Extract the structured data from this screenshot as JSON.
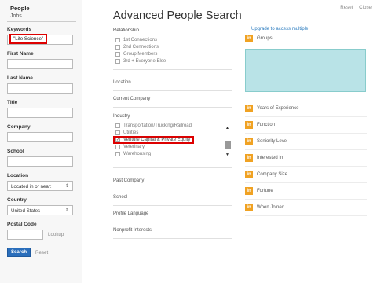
{
  "left": {
    "tabs": {
      "people": "People",
      "jobs": "Jobs"
    },
    "keywords": {
      "label": "Keywords",
      "value": "\"Life Science\""
    },
    "first_name": {
      "label": "First Name",
      "value": ""
    },
    "last_name": {
      "label": "Last Name",
      "value": ""
    },
    "title": {
      "label": "Title",
      "value": ""
    },
    "company": {
      "label": "Company",
      "value": ""
    },
    "school": {
      "label": "School",
      "value": ""
    },
    "location": {
      "label": "Location",
      "value": "Located in or near:"
    },
    "country": {
      "label": "Country",
      "value": "United States"
    },
    "postal": {
      "label": "Postal Code",
      "value": "",
      "lookup": "Lookup"
    },
    "search_label": "Search",
    "reset_label": "Reset"
  },
  "main": {
    "title": "Advanced People Search",
    "reset": "Reset",
    "close": "Close",
    "relationship": {
      "title": "Relationship",
      "options": [
        "1st Connections",
        "2nd Connections",
        "Group Members",
        "3rd + Everyone Else"
      ]
    },
    "location": "Location",
    "current_company": "Current Company",
    "industry": {
      "title": "Industry",
      "options": [
        "Transportation/Trucking/Railroad",
        "Utilities",
        "Venture Capital & Private Equity",
        "Veterinary",
        "Warehousing"
      ],
      "checked": "Venture Capital & Private Equity"
    },
    "past_company": "Past Company",
    "school": "School",
    "profile_language": "Profile Language",
    "nonprofit": "Nonprofit Interests",
    "upgrade": "Upgrade to access multiple",
    "groups": "Groups",
    "premium": [
      "Years of Experience",
      "Function",
      "Seniority Level",
      "Interested In",
      "Company Size",
      "Fortune",
      "When Joined"
    ],
    "badge": "in",
    "colors": {
      "accent": "#2a6ebb",
      "badge": "#f0a223",
      "highlight": "#dd0000"
    }
  }
}
